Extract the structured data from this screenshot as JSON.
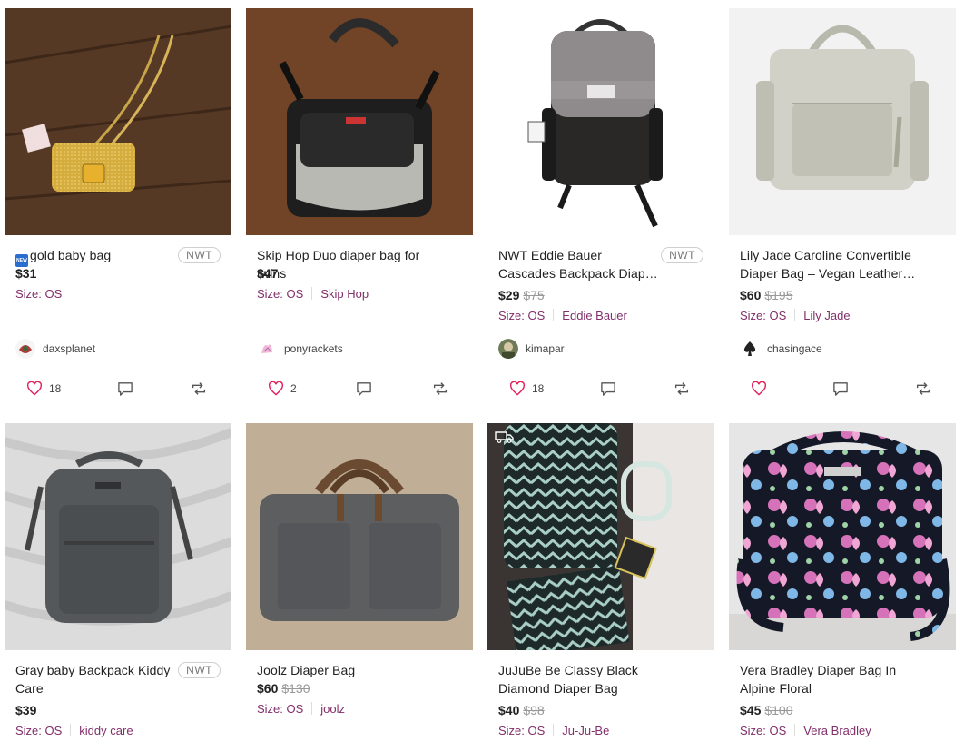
{
  "listings": [
    {
      "title": "gold baby bag",
      "has_new_badge": true,
      "new_badge_text": "NEW",
      "nwt": "NWT",
      "price": "$31",
      "original_price": "",
      "size": "Size: OS",
      "brand": "",
      "seller": "daxsplanet",
      "likes": "18",
      "colors": {
        "bg": "#5a3a26"
      }
    },
    {
      "title": "Skip Hop Duo diaper bag for twins",
      "nwt": "",
      "price": "$47",
      "original_price": "",
      "size": "Size: OS",
      "brand": "Skip Hop",
      "seller": "ponyrackets",
      "likes": "2"
    },
    {
      "title": "NWT Eddie Bauer Cascades Backpack Diap…",
      "nwt": "NWT",
      "price": "$29",
      "original_price": "$75",
      "size": "Size: OS",
      "brand": "Eddie Bauer",
      "seller": "kimapar",
      "likes": "18"
    },
    {
      "title": "Lily Jade Caroline Convertible Diaper Bag – Vegan Leather –…",
      "nwt": "",
      "price": "$60",
      "original_price": "$195",
      "size": "Size: OS",
      "brand": "Lily Jade",
      "seller": "chasingace",
      "likes": ""
    },
    {
      "title": "Gray baby Backpack Kiddy Care",
      "nwt": "NWT",
      "price": "$39",
      "original_price": "",
      "size": "Size: OS",
      "brand": "kiddy care"
    },
    {
      "title": "Joolz Diaper Bag",
      "nwt": "",
      "price": "$60",
      "original_price": "$130",
      "size": "Size: OS",
      "brand": "joolz"
    },
    {
      "title": "JuJuBe Be Classy Black Diamond Diaper Bag",
      "nwt": "",
      "price": "$40",
      "original_price": "$98",
      "size": "Size: OS",
      "brand": "Ju-Ju-Be"
    },
    {
      "title": "Vera Bradley Diaper Bag In Alpine Floral",
      "nwt": "",
      "price": "$45",
      "original_price": "$100",
      "size": "Size: OS",
      "brand": "Vera Bradley"
    }
  ],
  "icons": {
    "like": "heart-icon",
    "comment": "comment-icon",
    "share": "share-icon",
    "shipping": "truck-icon"
  },
  "colors": {
    "accent": "#822f6a",
    "like": "#e0245e"
  }
}
